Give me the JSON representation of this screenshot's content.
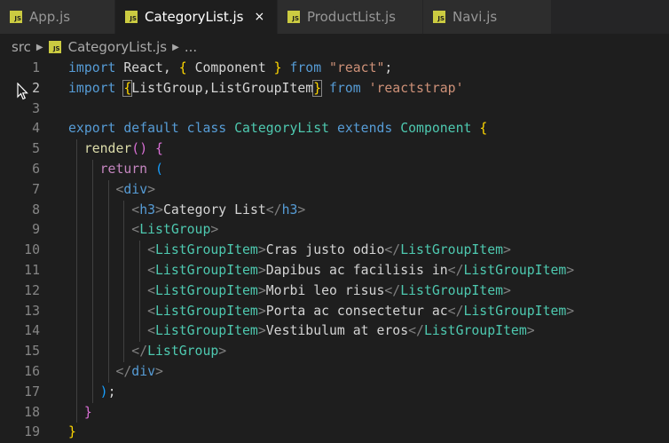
{
  "tabs": [
    {
      "label": "App.js",
      "active": false
    },
    {
      "label": "CategoryList.js",
      "active": true,
      "close": "×"
    },
    {
      "label": "ProductList.js",
      "active": false
    },
    {
      "label": "Navi.js",
      "active": false
    }
  ],
  "icon_text": "JS",
  "breadcrumb": {
    "folder": "src",
    "file": "CategoryList.js",
    "more": "..."
  },
  "colors": {
    "background": "#1e1e1e",
    "keyword": "#569cd6",
    "control": "#c586c0",
    "class": "#4ec9b0",
    "string": "#ce9178",
    "variable": "#9cdcfe",
    "function": "#dcdcaa",
    "js_icon": "#cbcb41"
  },
  "current_line": 2,
  "lines": [
    {
      "n": "1",
      "indent": 0,
      "tokens": [
        [
          "import",
          "kw"
        ],
        [
          " React, ",
          "tx"
        ],
        [
          "{",
          "gold"
        ],
        [
          " Component ",
          "tx"
        ],
        [
          "}",
          "gold"
        ],
        [
          " from ",
          "kw"
        ],
        [
          "\"react\"",
          "str"
        ],
        [
          ";",
          "tx"
        ]
      ]
    },
    {
      "n": "2",
      "indent": 0,
      "tokens": [
        [
          "import",
          "kw"
        ],
        [
          " ",
          "tx"
        ],
        [
          "{",
          "gold match"
        ],
        [
          "ListGroup,ListGroupItem",
          "tx"
        ],
        [
          "}",
          "gold match"
        ],
        [
          " from ",
          "kw"
        ],
        [
          "'reactstrap'",
          "str"
        ]
      ]
    },
    {
      "n": "3",
      "indent": 0,
      "tokens": []
    },
    {
      "n": "4",
      "indent": 0,
      "tokens": [
        [
          "export",
          "kw"
        ],
        [
          " ",
          "tx"
        ],
        [
          "default",
          "kw"
        ],
        [
          " ",
          "tx"
        ],
        [
          "class",
          "kw"
        ],
        [
          " ",
          "tx"
        ],
        [
          "CategoryList",
          "cls"
        ],
        [
          " ",
          "tx"
        ],
        [
          "extends",
          "kw"
        ],
        [
          " ",
          "tx"
        ],
        [
          "Component",
          "cls"
        ],
        [
          " ",
          "tx"
        ],
        [
          "{",
          "gold"
        ]
      ]
    },
    {
      "n": "5",
      "indent": 1,
      "tokens": [
        [
          "render",
          "fn"
        ],
        [
          "()",
          "pink"
        ],
        [
          " ",
          "tx"
        ],
        [
          "{",
          "pink"
        ]
      ]
    },
    {
      "n": "6",
      "indent": 2,
      "tokens": [
        [
          "return",
          "ctrl"
        ],
        [
          " ",
          "tx"
        ],
        [
          "(",
          "blue"
        ]
      ]
    },
    {
      "n": "7",
      "indent": 3,
      "tokens": [
        [
          "<",
          "br"
        ],
        [
          "div",
          "tag"
        ],
        [
          ">",
          "br"
        ]
      ]
    },
    {
      "n": "8",
      "indent": 4,
      "tokens": [
        [
          "<",
          "br"
        ],
        [
          "h3",
          "tag"
        ],
        [
          ">",
          "br"
        ],
        [
          "Category List",
          "tx"
        ],
        [
          "</",
          "br"
        ],
        [
          "h3",
          "tag"
        ],
        [
          ">",
          "br"
        ]
      ]
    },
    {
      "n": "9",
      "indent": 4,
      "tokens": [
        [
          "<",
          "br"
        ],
        [
          "ListGroup",
          "cls"
        ],
        [
          ">",
          "br"
        ]
      ]
    },
    {
      "n": "10",
      "indent": 5,
      "tokens": [
        [
          "<",
          "br"
        ],
        [
          "ListGroupItem",
          "cls"
        ],
        [
          ">",
          "br"
        ],
        [
          "Cras justo odio",
          "tx"
        ],
        [
          "</",
          "br"
        ],
        [
          "ListGroupItem",
          "cls"
        ],
        [
          ">",
          "br"
        ]
      ]
    },
    {
      "n": "11",
      "indent": 5,
      "tokens": [
        [
          "<",
          "br"
        ],
        [
          "ListGroupItem",
          "cls"
        ],
        [
          ">",
          "br"
        ],
        [
          "Dapibus ac facilisis in",
          "tx"
        ],
        [
          "</",
          "br"
        ],
        [
          "ListGroupItem",
          "cls"
        ],
        [
          ">",
          "br"
        ]
      ]
    },
    {
      "n": "12",
      "indent": 5,
      "tokens": [
        [
          "<",
          "br"
        ],
        [
          "ListGroupItem",
          "cls"
        ],
        [
          ">",
          "br"
        ],
        [
          "Morbi leo risus",
          "tx"
        ],
        [
          "</",
          "br"
        ],
        [
          "ListGroupItem",
          "cls"
        ],
        [
          ">",
          "br"
        ]
      ]
    },
    {
      "n": "13",
      "indent": 5,
      "tokens": [
        [
          "<",
          "br"
        ],
        [
          "ListGroupItem",
          "cls"
        ],
        [
          ">",
          "br"
        ],
        [
          "Porta ac consectetur ac",
          "tx"
        ],
        [
          "</",
          "br"
        ],
        [
          "ListGroupItem",
          "cls"
        ],
        [
          ">",
          "br"
        ]
      ]
    },
    {
      "n": "14",
      "indent": 5,
      "tokens": [
        [
          "<",
          "br"
        ],
        [
          "ListGroupItem",
          "cls"
        ],
        [
          ">",
          "br"
        ],
        [
          "Vestibulum at eros",
          "tx"
        ],
        [
          "</",
          "br"
        ],
        [
          "ListGroupItem",
          "cls"
        ],
        [
          ">",
          "br"
        ]
      ]
    },
    {
      "n": "15",
      "indent": 4,
      "tokens": [
        [
          "</",
          "br"
        ],
        [
          "ListGroup",
          "cls"
        ],
        [
          ">",
          "br"
        ]
      ]
    },
    {
      "n": "16",
      "indent": 3,
      "tokens": [
        [
          "</",
          "br"
        ],
        [
          "div",
          "tag"
        ],
        [
          ">",
          "br"
        ]
      ]
    },
    {
      "n": "17",
      "indent": 2,
      "tokens": [
        [
          ")",
          "blue"
        ],
        [
          ";",
          "tx"
        ]
      ]
    },
    {
      "n": "18",
      "indent": 1,
      "tokens": [
        [
          "}",
          "pink"
        ]
      ]
    },
    {
      "n": "19",
      "indent": 0,
      "tokens": [
        [
          "}",
          "gold"
        ]
      ]
    }
  ]
}
